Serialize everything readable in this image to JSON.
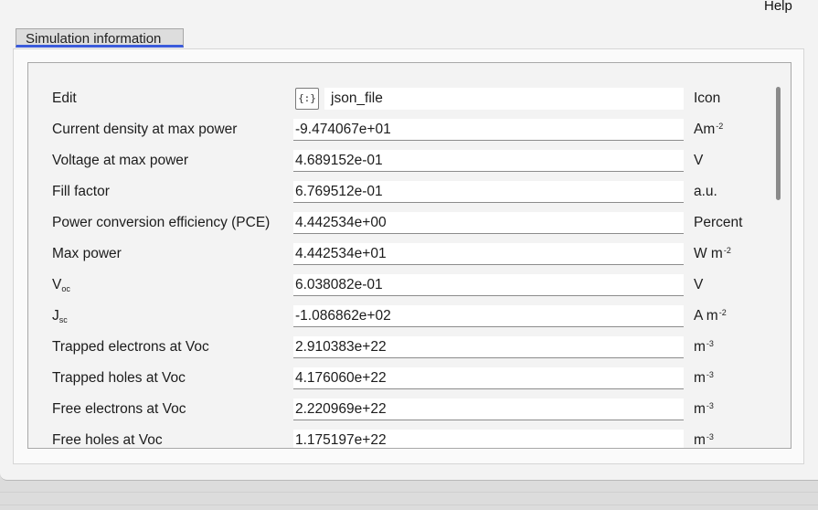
{
  "menu": {
    "help": "Help"
  },
  "tab": {
    "label": "Simulation information"
  },
  "edit_row": {
    "label": "Edit",
    "icon_glyph": "{:}",
    "value": "json_file",
    "unit": "Icon"
  },
  "rows": [
    {
      "label": "Current density at max power",
      "value": "-9.474067e+01",
      "unit": "Am",
      "unit_sup": "-2"
    },
    {
      "label": "Voltage at max power",
      "value": "4.689152e-01",
      "unit": "V",
      "unit_sup": ""
    },
    {
      "label": "Fill factor",
      "value": "6.769512e-01",
      "unit": "a.u.",
      "unit_sup": ""
    },
    {
      "label": "Power conversion efficiency (PCE)",
      "value": "4.442534e+00",
      "unit": "Percent",
      "unit_sup": ""
    },
    {
      "label": "Max power",
      "value": "4.442534e+01",
      "unit": "W m",
      "unit_sup": "-2"
    },
    {
      "label": "V",
      "label_sub": "oc",
      "value": "6.038082e-01",
      "unit": "V",
      "unit_sup": ""
    },
    {
      "label": "J",
      "label_sub": "sc",
      "value": "-1.086862e+02",
      "unit": "A m",
      "unit_sup": "-2"
    },
    {
      "label": "Trapped electrons at Voc",
      "value": "2.910383e+22",
      "unit": "m",
      "unit_sup": "-3"
    },
    {
      "label": "Trapped holes at Voc",
      "value": "4.176060e+22",
      "unit": "m",
      "unit_sup": "-3"
    },
    {
      "label": "Free electrons at Voc",
      "value": "2.220969e+22",
      "unit": "m",
      "unit_sup": "-3"
    },
    {
      "label": "Free holes at Voc",
      "value": "1.175197e+22",
      "unit": "m",
      "unit_sup": "-3"
    }
  ]
}
